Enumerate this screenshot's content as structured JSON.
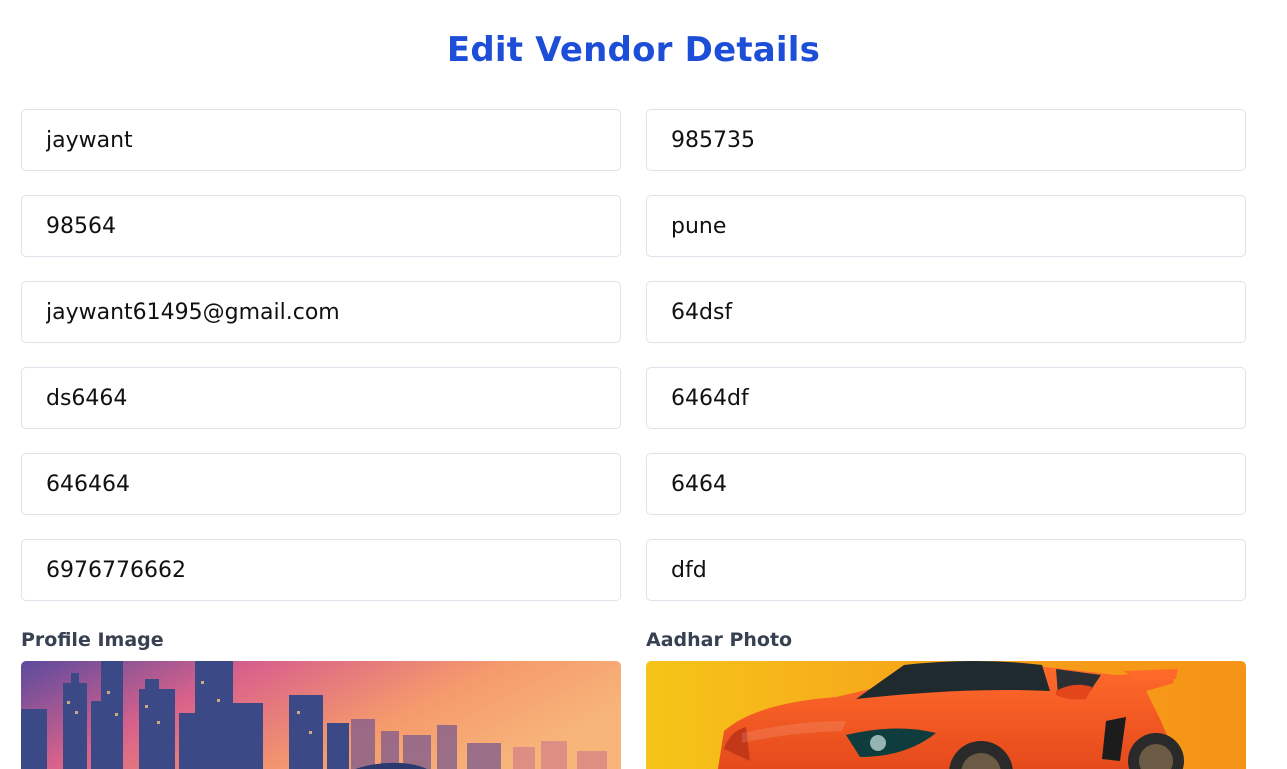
{
  "page": {
    "title": "Edit Vendor Details"
  },
  "fields": [
    {
      "value": "jaywant"
    },
    {
      "value": "985735"
    },
    {
      "value": "98564"
    },
    {
      "value": "pune"
    },
    {
      "value": "jaywant61495@gmail.com"
    },
    {
      "value": "64dsf"
    },
    {
      "value": "ds6464"
    },
    {
      "value": "6464df"
    },
    {
      "value": "646464"
    },
    {
      "value": "6464"
    },
    {
      "value": "6976776662"
    },
    {
      "value": "dfd"
    }
  ],
  "images": {
    "profile_label": "Profile Image",
    "aadhar_label": "Aadhar Photo"
  },
  "colors": {
    "accent": "#1d4ed8",
    "label": "#374151",
    "border": "#dde3ea"
  }
}
